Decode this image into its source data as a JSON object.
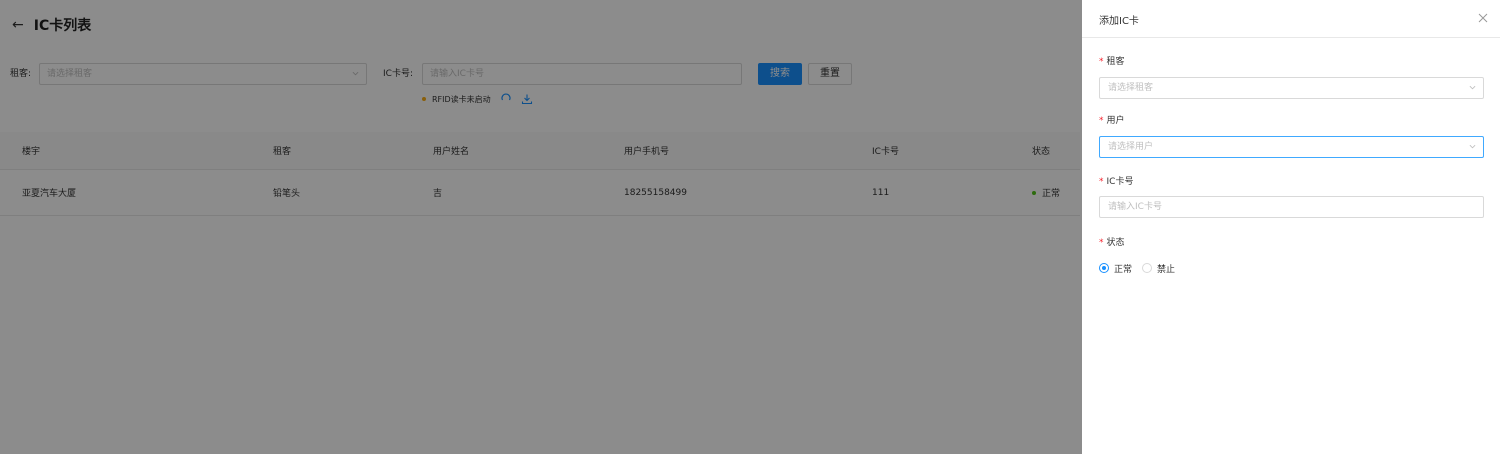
{
  "header": {
    "title": "IC卡列表"
  },
  "filters": {
    "tenant_label": "租客:",
    "tenant_placeholder": "请选择租客",
    "card_label": "IC卡号:",
    "card_placeholder": "请输入IC卡号",
    "search_label": "搜索",
    "reset_label": "重置"
  },
  "rfid": {
    "status": "RFID读卡未启动"
  },
  "table": {
    "columns": [
      "楼宇",
      "租客",
      "用户姓名",
      "用户手机号",
      "IC卡号",
      "状态"
    ],
    "rows": [
      {
        "building": "亚夏汽车大厦",
        "tenant": "铅笔头",
        "name": "吉",
        "phone": "18255158499",
        "card": "111",
        "status": "正常"
      }
    ]
  },
  "drawer": {
    "title": "添加IC卡",
    "fields": {
      "tenant": {
        "label": "租客",
        "placeholder": "请选择租客"
      },
      "user": {
        "label": "用户",
        "placeholder": "请选择用户"
      },
      "card": {
        "label": "IC卡号",
        "placeholder": "请输入IC卡号"
      },
      "status": {
        "label": "状态",
        "options": [
          "正常",
          "禁止"
        ],
        "selected": "正常"
      }
    }
  },
  "colors": {
    "primary": "#1890ff",
    "required": "#f5222d",
    "success": "#52c41a",
    "warning": "#faad14"
  },
  "icons": {
    "back": "arrow-left-icon",
    "close": "close-icon",
    "refresh": "refresh-icon",
    "download": "download-icon",
    "chevron": "chevron-down-icon"
  }
}
